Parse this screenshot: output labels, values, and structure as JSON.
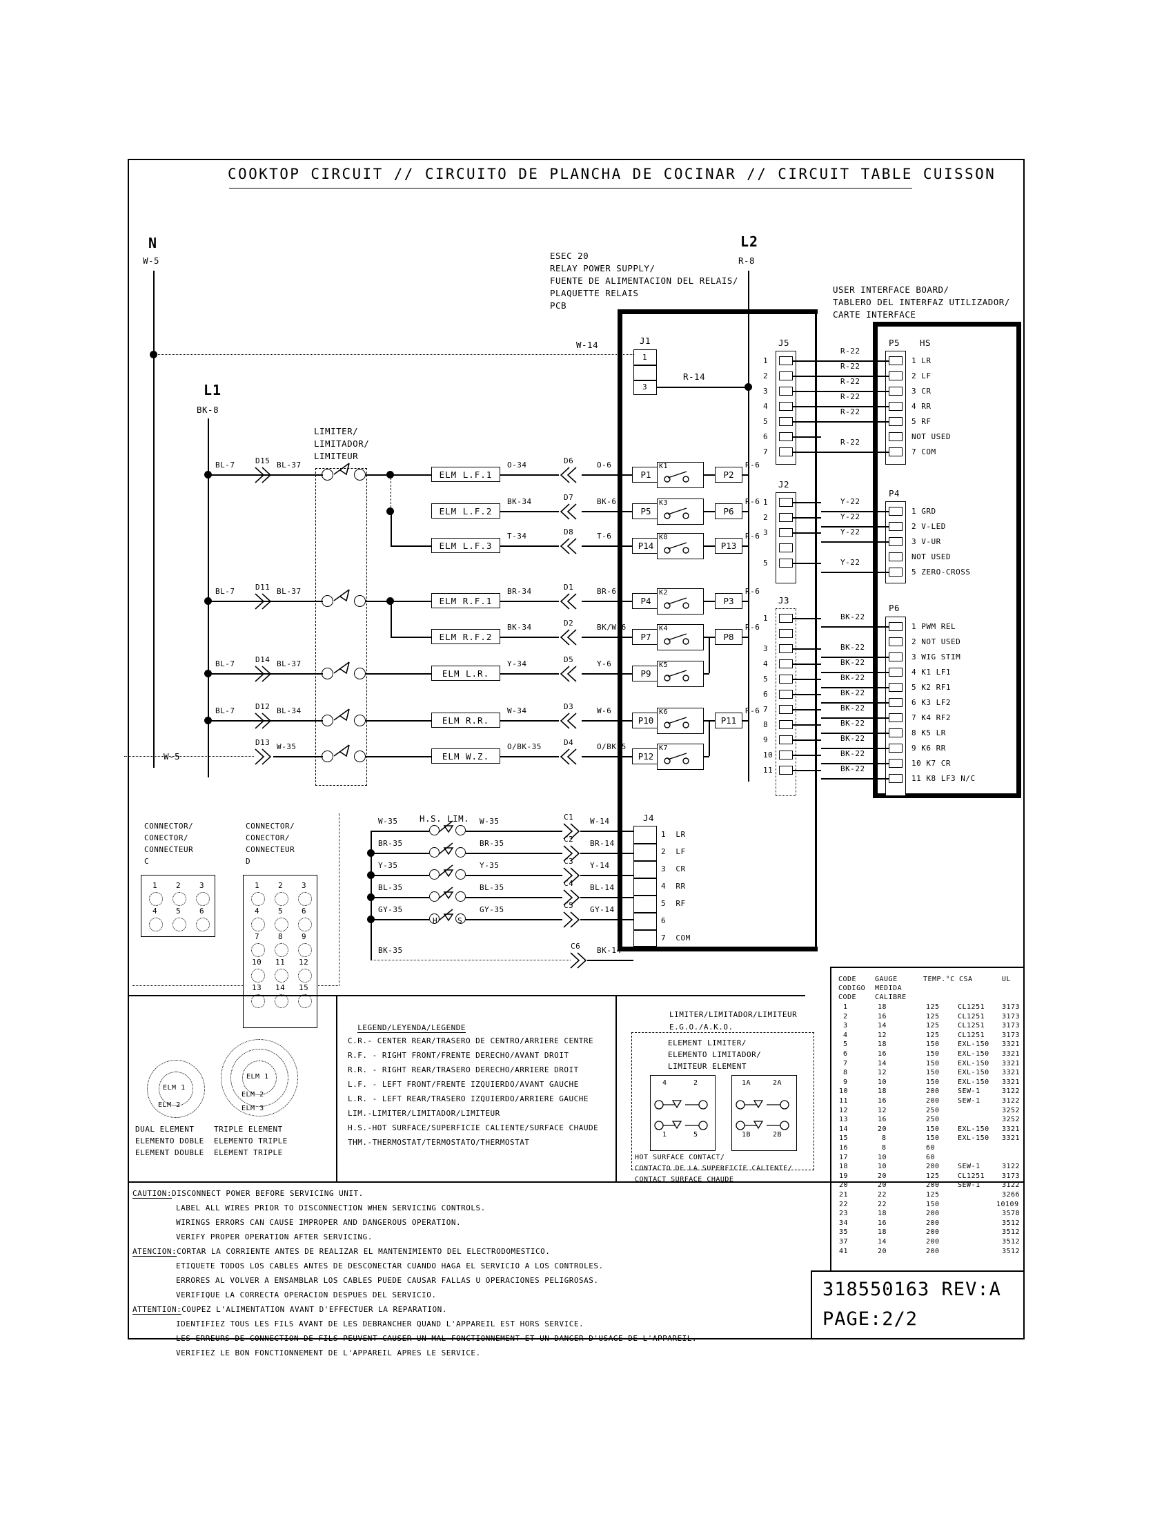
{
  "title": "COOKTOP CIRCUIT // CIRCUITO DE PLANCHA DE COCINAR // CIRCUIT TABLE CUISSON",
  "supply": {
    "n_label": "N",
    "n_wire": "W-5",
    "l1_label": "L1",
    "l1_wire": "BK-8",
    "l2_label": "L2",
    "l2_wire": "R-8",
    "w5_left": "W-5",
    "w14": "W-14",
    "r14": "R-14"
  },
  "relay_board": {
    "caption": [
      "ESEC 20",
      "RELAY POWER SUPPLY/",
      "FUENTE DE ALIMENTACION DEL RELAIS/",
      "PLAQUETTE RELAIS",
      "PCB"
    ],
    "j1_label": "J1",
    "j1_pins": [
      "1",
      "",
      "3"
    ],
    "j4_label": "J4",
    "j4_pins": [
      {
        "n": "1",
        "name": "LR"
      },
      {
        "n": "2",
        "name": "LF"
      },
      {
        "n": "3",
        "name": "CR"
      },
      {
        "n": "4",
        "name": "RR"
      },
      {
        "n": "5",
        "name": "RF"
      },
      {
        "n": "6",
        "name": ""
      },
      {
        "n": "7",
        "name": "COM"
      }
    ]
  },
  "ui_board": {
    "caption": [
      "USER INTERFACE BOARD/",
      "TABLERO DEL INTERFAZ UTILIZADOR/",
      "CARTE INTERFACE"
    ],
    "p5": {
      "label": "P5",
      "sub": "HS",
      "pins": [
        "1 LR",
        "2 LF",
        "3 CR",
        "4 RR",
        "5 RF",
        "NOT USED",
        "7 COM"
      ],
      "wires": [
        "R-22",
        "R-22",
        "R-22",
        "R-22",
        "R-22",
        "",
        "R-22"
      ]
    },
    "p4": {
      "label": "P4",
      "pins": [
        "1 GRD",
        "2 V-LED",
        "3 V-UR",
        "NOT USED",
        "5 ZERO-CROSS"
      ],
      "wires": [
        "Y-22",
        "Y-22",
        "Y-22",
        "",
        "Y-22"
      ]
    },
    "p6": {
      "label": "P6",
      "pins": [
        "1 PWM REL",
        "2 NOT USED",
        "3 WIG STIM",
        "4 K1 LF1",
        "5 K2 RF1",
        "6 K3 LF2",
        "7 K4 RF2",
        "8 K5 LR",
        "9 K6 RR",
        "10 K7 CR",
        "11 K8 LF3 N/C"
      ],
      "wires": [
        "BK-22",
        "",
        "BK-22",
        "BK-22",
        "BK-22",
        "BK-22",
        "BK-22",
        "BK-22",
        "BK-22",
        "BK-22",
        "BK-22"
      ]
    }
  },
  "j_connectors": {
    "j5": {
      "label": "J5",
      "pins": [
        "1",
        "2",
        "3",
        "4",
        "5",
        "6",
        "7"
      ]
    },
    "j2": {
      "label": "J2",
      "pins": [
        "1",
        "2",
        "3",
        "",
        "5"
      ]
    },
    "j3": {
      "label": "J3",
      "pins": [
        "1",
        "",
        "3",
        "4",
        "5",
        "6",
        "7",
        "8",
        "9",
        "10",
        "11"
      ]
    }
  },
  "limiter": {
    "caption": [
      "LIMITER/",
      "LIMITADOR/",
      "LIMITEUR"
    ]
  },
  "element_rows": [
    {
      "in_wire": "BL-7",
      "dnum": "D15",
      "mid_wire": "BL-37",
      "elm": "ELM L.F.1",
      "out_wire": "O-34",
      "out_d": "D6",
      "right_wire": "O-6",
      "pin_in": "P1",
      "relay": "K1",
      "pin_out": "P2",
      "out_right": "R-6"
    },
    {
      "in_wire": "",
      "dnum": "",
      "mid_wire": "",
      "elm": "ELM L.F.2",
      "out_wire": "BK-34",
      "out_d": "D7",
      "right_wire": "BK-6",
      "pin_in": "P5",
      "relay": "K3",
      "pin_out": "P6",
      "out_right": "R-6"
    },
    {
      "in_wire": "",
      "dnum": "",
      "mid_wire": "",
      "elm": "ELM L.F.3",
      "out_wire": "T-34",
      "out_d": "D8",
      "right_wire": "T-6",
      "pin_in": "P14",
      "relay": "K8",
      "pin_out": "P13",
      "out_right": "R-6"
    },
    {
      "in_wire": "BL-7",
      "dnum": "D11",
      "mid_wire": "BL-37",
      "elm": "ELM R.F.1",
      "out_wire": "BR-34",
      "out_d": "D1",
      "right_wire": "BR-6",
      "pin_in": "P4",
      "relay": "K2",
      "pin_out": "P3",
      "out_right": "R-6"
    },
    {
      "in_wire": "",
      "dnum": "",
      "mid_wire": "",
      "elm": "ELM R.F.2",
      "out_wire": "BK-34",
      "out_d": "D2",
      "right_wire": "BK/W-6",
      "pin_in": "P7",
      "relay": "K4",
      "pin_out": "P8",
      "out_right": "R-6"
    },
    {
      "in_wire": "BL-7",
      "dnum": "D14",
      "mid_wire": "BL-37",
      "elm": "ELM L.R.",
      "out_wire": "Y-34",
      "out_d": "D5",
      "right_wire": "Y-6",
      "pin_in": "P9",
      "relay": "K5",
      "pin_out": "",
      "out_right": ""
    },
    {
      "in_wire": "BL-7",
      "dnum": "D12",
      "mid_wire": "BL-34",
      "elm": "ELM R.R.",
      "out_wire": "W-34",
      "out_d": "D3",
      "right_wire": "W-6",
      "pin_in": "P10",
      "relay": "K6",
      "pin_out": "P11",
      "out_right": "R-6"
    },
    {
      "in_wire": "",
      "dnum": "D13",
      "mid_wire": "W-35",
      "elm": "ELM W.Z.",
      "out_wire": "O/BK-35",
      "out_d": "D4",
      "right_wire": "O/BK-5",
      "pin_in": "P12",
      "relay": "K7",
      "pin_out": "",
      "out_right": ""
    }
  ],
  "hs_lim": {
    "label": "H.S. LIM.",
    "h_label": "H",
    "s_label": "S",
    "rows": [
      {
        "in": "W-35",
        "mid": "W-35",
        "c": "C1",
        "out": "W-14"
      },
      {
        "in": "BR-35",
        "mid": "BR-35",
        "c": "C2",
        "out": "BR-14"
      },
      {
        "in": "Y-35",
        "mid": "Y-35",
        "c": "C3",
        "out": "Y-14"
      },
      {
        "in": "BL-35",
        "mid": "BL-35",
        "c": "C4",
        "out": "BL-14"
      },
      {
        "in": "GY-35",
        "mid": "GY-35",
        "c": "C5",
        "out": "GY-14"
      },
      {
        "in": "BK-35",
        "mid": "",
        "c": "C6",
        "out": "BK-14"
      }
    ]
  },
  "connector_c": {
    "caption": [
      "CONNECTOR/",
      "CONECTOR/",
      "CONNECTEUR",
      "C"
    ],
    "pins": [
      "1",
      "2",
      "3",
      "4",
      "5",
      "6"
    ]
  },
  "connector_d": {
    "caption": [
      "CONNECTOR/",
      "CONECTOR/",
      "CONNECTEUR",
      "D"
    ],
    "pins": [
      "1",
      "2",
      "3",
      "4",
      "5",
      "6",
      "7",
      "8",
      "9",
      "10",
      "11",
      "12",
      "13",
      "14",
      "15"
    ]
  },
  "elements": {
    "dual": {
      "rings": [
        "ELM 1",
        "ELM 2"
      ],
      "caption": [
        "DUAL ELEMENT",
        "ELEMENTO DOBLE",
        "ELEMENT DOUBLE"
      ]
    },
    "triple": {
      "rings": [
        "ELM 1",
        "ELM 2",
        "ELM 3"
      ],
      "caption": [
        "TRIPLE ELEMENT",
        "ELEMENTO TRIPLE",
        "ELEMENT TRIPLE"
      ]
    }
  },
  "legend": {
    "heading": "LEGEND/LEYENDA/LEGENDE",
    "entries": [
      "C.R.- CENTER REAR/TRASERO DE CENTRO/ARRIERE CENTRE",
      "R.F. - RIGHT FRONT/FRENTE DERECHO/AVANT DROIT",
      "R.R. - RIGHT REAR/TRASERO DERECHO/ARRIERE DROIT",
      "L.F. - LEFT FRONT/FRENTE IZQUIERDO/AVANT GAUCHE",
      "L.R. - LEFT REAR/TRASERO IZQUIERDO/ARRIERE GAUCHE",
      "LIM.-LIMITER/LIMITADOR/LIMITEUR",
      "H.S.-HOT SURFACE/SUPERFICIE CALIENTE/SURFACE CHAUDE",
      "THM.-THERMOSTAT/TERMOSTATO/THERMOSTAT"
    ]
  },
  "limiter_detail": {
    "heading": "LIMITER/LIMITADOR/LIMITEUR",
    "sub": "E.G.O./A.K.O.",
    "inner": [
      "ELEMENT LIMITER/",
      "ELEMENTO LIMITADOR/",
      "LIMITEUR ELEMENT"
    ],
    "left_pins": [
      "4",
      "2",
      "1",
      "5"
    ],
    "right_pins": [
      "1A",
      "2A",
      "1B",
      "2B"
    ],
    "footer": [
      "HOT SURFACE CONTACT/",
      "CONTACTO DE LA SUPERFICIE CALIENTE/",
      "CONTACT SURFACE CHAUDE"
    ]
  },
  "wire_table": {
    "headers_row1": [
      "CODE",
      "GAUGE",
      "TEMP.°C",
      "CSA",
      "UL"
    ],
    "headers_row2": [
      "CODIGO",
      "MEDIDA",
      "",
      "",
      ""
    ],
    "headers_row3": [
      "CODE",
      "CALIBRE",
      "",
      "",
      ""
    ],
    "rows": [
      [
        "1",
        "18",
        "125",
        "CL1251",
        "3173"
      ],
      [
        "2",
        "16",
        "125",
        "CL1251",
        "3173"
      ],
      [
        "3",
        "14",
        "125",
        "CL1251",
        "3173"
      ],
      [
        "4",
        "12",
        "125",
        "CL1251",
        "3173"
      ],
      [
        "5",
        "18",
        "150",
        "EXL-150",
        "3321"
      ],
      [
        "6",
        "16",
        "150",
        "EXL-150",
        "3321"
      ],
      [
        "7",
        "14",
        "150",
        "EXL-150",
        "3321"
      ],
      [
        "8",
        "12",
        "150",
        "EXL-150",
        "3321"
      ],
      [
        "9",
        "10",
        "150",
        "EXL-150",
        "3321"
      ],
      [
        "10",
        "18",
        "200",
        "SEW-1",
        "3122"
      ],
      [
        "11",
        "16",
        "200",
        "SEW-1",
        "3122"
      ],
      [
        "12",
        "12",
        "250",
        "",
        "3252"
      ],
      [
        "13",
        "16",
        "250",
        "",
        "3252"
      ],
      [
        "14",
        "20",
        "150",
        "EXL-150",
        "3321"
      ],
      [
        "15",
        "8",
        "150",
        "EXL-150",
        "3321"
      ],
      [
        "16",
        "8",
        "60",
        "",
        ""
      ],
      [
        "17",
        "10",
        "60",
        "",
        ""
      ],
      [
        "18",
        "10",
        "200",
        "SEW-1",
        "3122"
      ],
      [
        "19",
        "20",
        "125",
        "CL1251",
        "3173"
      ],
      [
        "20",
        "20",
        "200",
        "SEW-1",
        "3122"
      ],
      [
        "21",
        "22",
        "125",
        "",
        "3266"
      ],
      [
        "22",
        "22",
        "150",
        "",
        "10109"
      ],
      [
        "23",
        "18",
        "200",
        "",
        "3578"
      ],
      [
        "34",
        "16",
        "200",
        "",
        "3512"
      ],
      [
        "35",
        "18",
        "200",
        "",
        "3512"
      ],
      [
        "37",
        "14",
        "200",
        "",
        "3512"
      ],
      [
        "41",
        "20",
        "200",
        "",
        "3512"
      ]
    ]
  },
  "caution": {
    "blocks": [
      {
        "kw": "CAUTION:",
        "first": "DISCONNECT POWER BEFORE SERVICING UNIT.",
        "rest": [
          "LABEL ALL WIRES PRIOR TO DISCONNECTION WHEN SERVICING CONTROLS.",
          "WIRINGS ERRORS CAN CAUSE IMPROPER AND DANGEROUS OPERATION.",
          "VERIFY PROPER OPERATION AFTER SERVICING."
        ]
      },
      {
        "kw": "ATENCION:",
        "first": "CORTAR LA CORRIENTE ANTES DE REALIZAR EL MANTENIMIENTO DEL ELECTRODOMESTICO.",
        "rest": [
          "ETIQUETE TODOS LOS CABLES ANTES DE DESCONECTAR CUANDO HAGA EL SERVICIO A LOS CONTROLES.",
          "ERRORES AL VOLVER A ENSAMBLAR LOS CABLES PUEDE CAUSAR FALLAS U OPERACIONES PELIGROSAS.",
          "VERIFIQUE LA CORRECTA OPERACION DESPUES DEL SERVICIO."
        ]
      },
      {
        "kw": "ATTENTION:",
        "first": "COUPEZ L'ALIMENTATION AVANT D'EFFECTUER LA REPARATION.",
        "rest": [
          "IDENTIFIEZ TOUS LES FILS AVANT DE LES DEBRANCHER QUAND L'APPAREIL EST HORS SERVICE.",
          "LES ERREURS DE CONNECTION DE FILS PEUVENT CAUSER UN MAL FONCTIONNEMENT ET UN DANGER D'USAGE DE L'APPAREIL.",
          "VERIFIEZ LE BON FONCTIONNEMENT DE L'APPAREIL APRES LE SERVICE."
        ]
      }
    ]
  },
  "part": {
    "number": "318550163 REV:A",
    "page": "PAGE:2/2"
  }
}
